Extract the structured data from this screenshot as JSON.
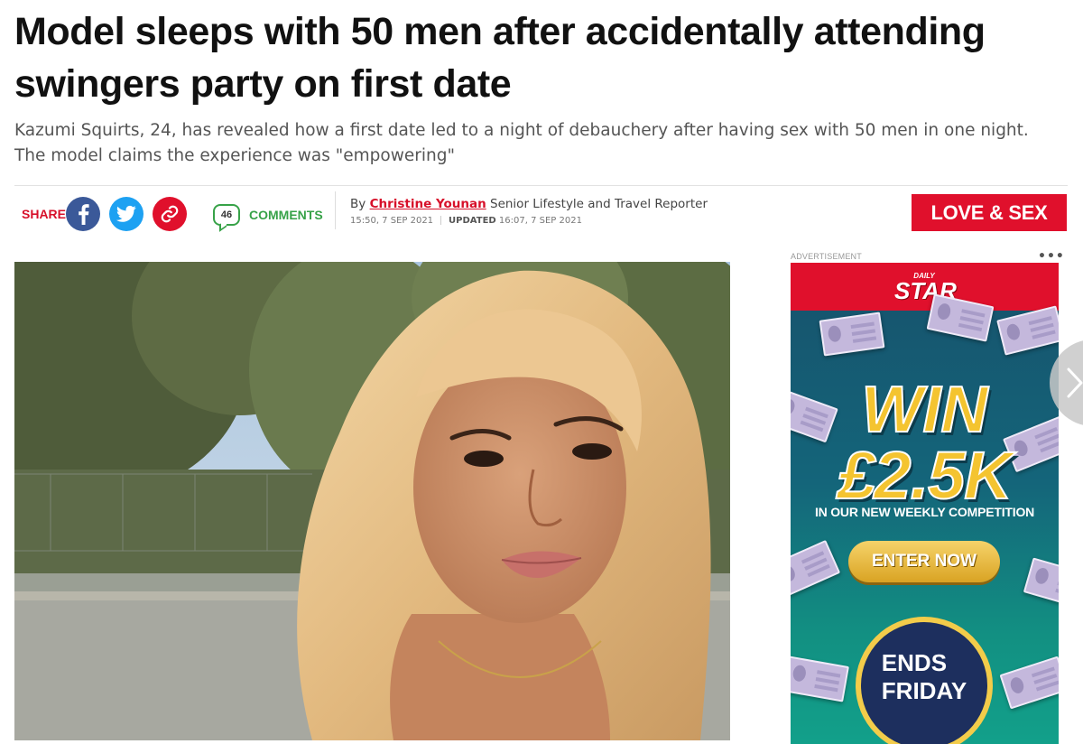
{
  "article": {
    "headline": "Model sleeps with 50 men after accidentally attending swingers party on first date",
    "standfirst": "Kazumi Squirts, 24, has revealed how a first date led to a night of debauchery after having sex with 50 men in one night. The model claims the experience was \"empowering\""
  },
  "share": {
    "label": "SHARE",
    "buttons": [
      {
        "name": "facebook",
        "icon": "facebook-icon",
        "color": "#3b5999"
      },
      {
        "name": "twitter",
        "icon": "twitter-icon",
        "color": "#1da1f2"
      },
      {
        "name": "copy-link",
        "icon": "link-icon",
        "color": "#e0102c"
      }
    ]
  },
  "comments": {
    "count": "46",
    "label": "COMMENTS",
    "color": "#37a248"
  },
  "byline": {
    "prefix": "By",
    "author": "Christine Younan",
    "role": "Senior Lifestyle and Travel Reporter",
    "published": "15:50, 7 SEP 2021",
    "updated_label": "UPDATED",
    "updated": "16:07, 7 SEP 2021"
  },
  "section_tag": "LOVE & SEX",
  "ad": {
    "label": "ADVERTISEMENT",
    "menu": "•••",
    "brand_small": "DAILY",
    "brand": "STAR",
    "win": "WIN",
    "amount": "£2.5K",
    "subtitle": "IN OUR NEW WEEKLY COMPETITION",
    "cta": "ENTER NOW",
    "ends_line1": "ENDS",
    "ends_line2": "FRIDAY"
  },
  "colors": {
    "brand_red": "#e0102c",
    "headline": "#111111",
    "standfirst": "#555555",
    "ad_gold": "#f4c430",
    "ad_teal": "#15607a"
  }
}
